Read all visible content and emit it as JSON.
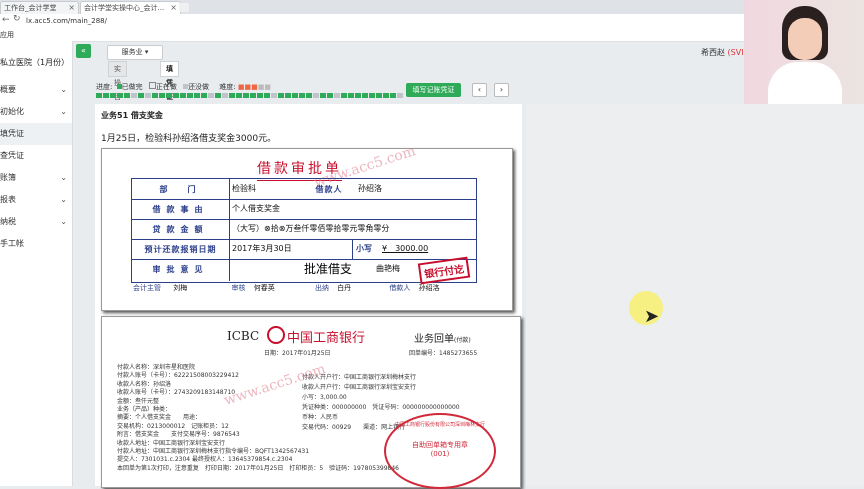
{
  "browser": {
    "tabs": [
      {
        "label": "工作台_会计学堂"
      },
      {
        "label": "会计学堂实操中心_会计..."
      }
    ],
    "url": "lx.acc5.com/main_288/",
    "bookmarks": "应用"
  },
  "sidebar": {
    "company": "私立医院（1月份）",
    "items": [
      {
        "label": "概要"
      },
      {
        "label": "初始化"
      },
      {
        "label": "填凭证"
      },
      {
        "label": "查凭证"
      },
      {
        "label": "账簿"
      },
      {
        "label": "报表"
      },
      {
        "label": "纳税"
      },
      {
        "label": "手工帐"
      }
    ]
  },
  "toolbar": {
    "dept_label": "服务业",
    "user": "希西赵",
    "user_tag": "(SVI"
  },
  "tabs": [
    {
      "label": "实操目录树"
    },
    {
      "label": "填凭证"
    }
  ],
  "progress": {
    "label": "进度:",
    "legend_done": "已做完",
    "legend_doing": "正在做",
    "legend_todo": "还没做",
    "difficulty": "难度:",
    "fill_button": "填写记账凭证",
    "prev": "‹",
    "next": "›"
  },
  "task": {
    "title": "业务51 借支奖金",
    "desc": "1月25日，检验科孙绍洛借支奖金3000元。"
  },
  "loan_form": {
    "title": "借款审批单",
    "watermark": "www.acc5.com",
    "rows": {
      "dept_label": "部　门",
      "dept_value": "检验科",
      "borrower_label": "借款人",
      "borrower_value": "孙绍洛",
      "reason_label": "借款事由",
      "reason_value": "个人借支奖金",
      "amount_label": "贷款金额",
      "amount_value": "（大写）⊗拾⊗万叁仟零佰零拾零元零角零分",
      "date_label": "预计还款报销日期",
      "date_value": "2017年3月30日",
      "small_label": "小写",
      "small_value": "¥　3000.00",
      "opinion_label": "审批意见",
      "opinion_value": "批准借支",
      "approver": "曲艳梅",
      "stamp": "银行付讫"
    },
    "footer": {
      "supervisor_label": "会计主管",
      "supervisor": "刘梅",
      "review_label": "审核",
      "review": "何春英",
      "cashier_label": "出纳",
      "cashier": "白丹",
      "borrower_label": "借款人",
      "borrower": "孙绍洛"
    }
  },
  "bank_slip": {
    "icbc": "ICBC",
    "bank_name": "中国工商银行",
    "title": "业务回单",
    "title_sub": "(付款)",
    "date": "日期：2017年01月25日",
    "receipt_no": "回单编号：1485273655",
    "lines": [
      "付款人名称：深圳市星和医院",
      "付款人账号（卡号）：6222150800322941​2",
      "收款人名称：孙绍洛",
      "收款人账号（卡号）：274320918314871​0",
      "金额：叁仟元整",
      "业务（产品）种类：",
      "摘要：个人借支奖金　　用途：",
      "交易机构：0213000012　记账柜员：12",
      "附言：借支奖金　　支付交易序号：9876543",
      "收款人地址：中国工商银行深圳宝安支行",
      "付款人地址：中国工商银行深圳梅林支行指令编号：BQFT1342567431",
      "提交人：7301031.c.2304 最终授权人：13645379854.c.2304",
      "本回单为第1次打印，注意重复　打印日期：2017年01月25日　打印柜员：5　验证码：19​780539​9846"
    ],
    "right_lines": [
      "付款人开户行：中国工商银行深圳梅林支行",
      "收款人开户行：中国工商银行深圳宝安支行",
      "小写：3,000.00",
      "凭证种类：000000000　凭证号码：000000000000000",
      "币种：人民币",
      "交易代码：00929　　渠道：网上银行"
    ],
    "stamp_text": "中国工商银行股份有限公司深圳梅林支行",
    "stamp_inner": "自助回单箱专用章",
    "stamp_no": "(001)"
  }
}
